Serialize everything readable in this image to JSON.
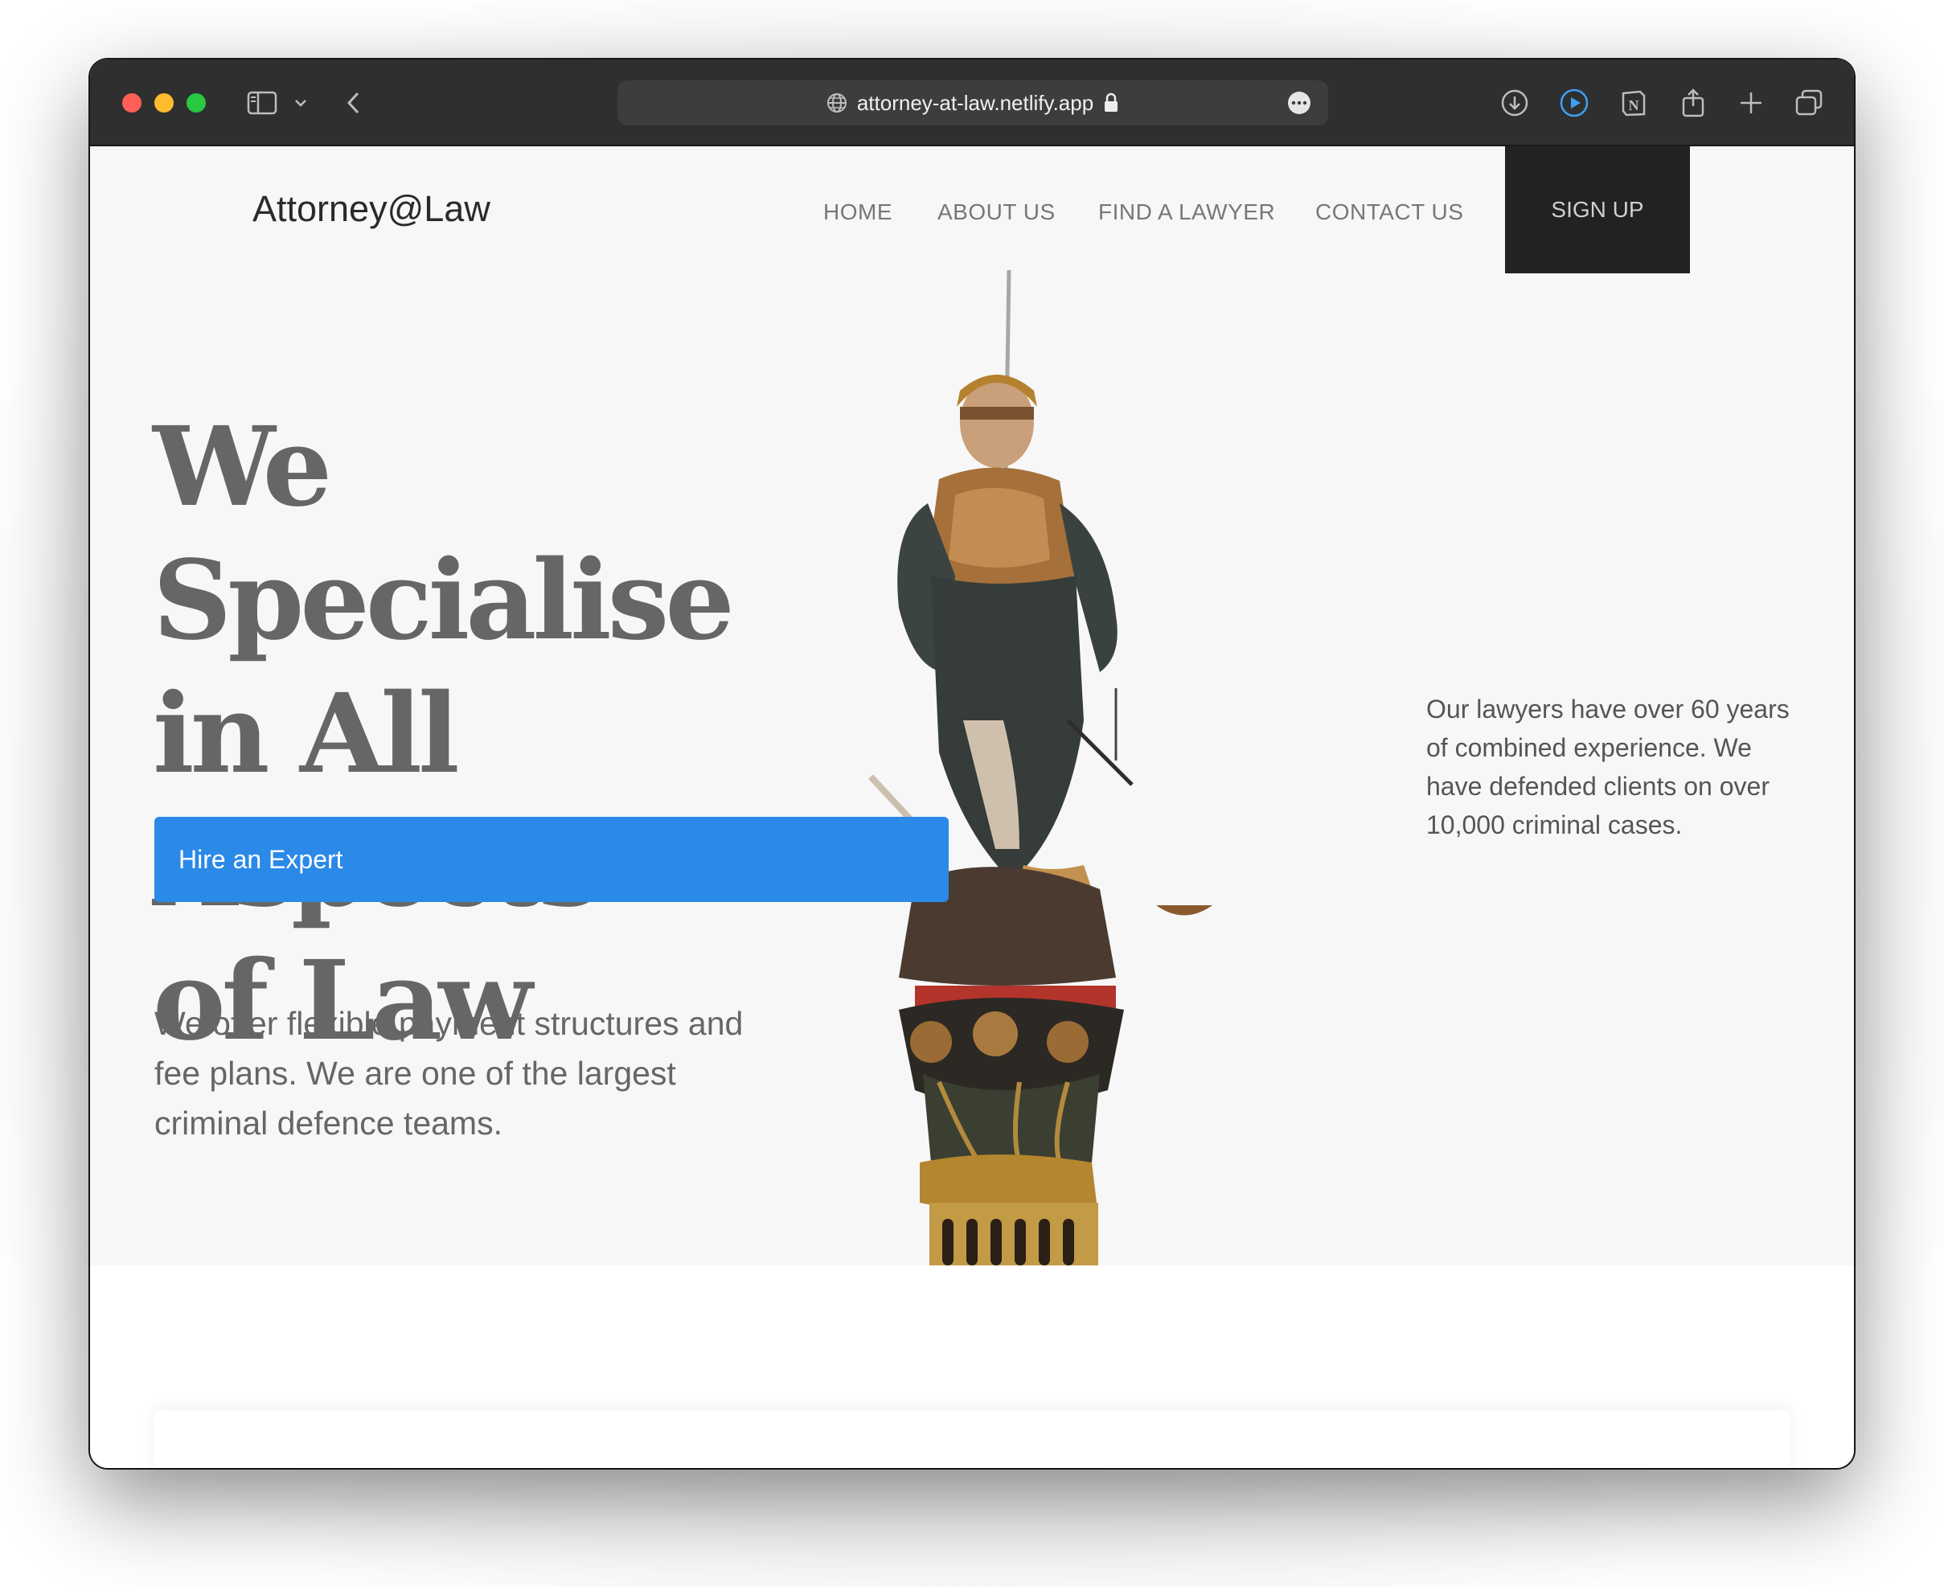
{
  "browser": {
    "url": "attorney-at-law.netlify.app",
    "icons": [
      "sidebar-icon",
      "chevron-down-icon",
      "back-icon",
      "globe-icon",
      "lock-icon",
      "more-icon",
      "download-icon",
      "play-icon",
      "notion-icon",
      "share-icon",
      "plus-icon",
      "tabs-icon"
    ]
  },
  "site": {
    "brand": "Attorney@Law",
    "nav": {
      "home": "HOME",
      "about": "ABOUT US",
      "find": "FIND A LAWYER",
      "contact": "CONTACT US",
      "signup": "SIGN UP"
    },
    "hero": {
      "headline_line1": "We Specialise",
      "headline_line2": "in All Aspects",
      "headline_line3": "of Law",
      "cta": "Hire an Expert",
      "lead": "We offer flexible payment structures and fee plans. We are one of the largest criminal defence teams.",
      "side": "Our lawyers have over 60 years of combined experience. We have defended clients on over 10,000 criminal cases."
    }
  },
  "colors": {
    "toolbar": "#2f2f2f",
    "hero_bg": "#f7f7f7",
    "signup_bg": "#222222",
    "cta": "#2b89e8",
    "headline": "#666666"
  }
}
